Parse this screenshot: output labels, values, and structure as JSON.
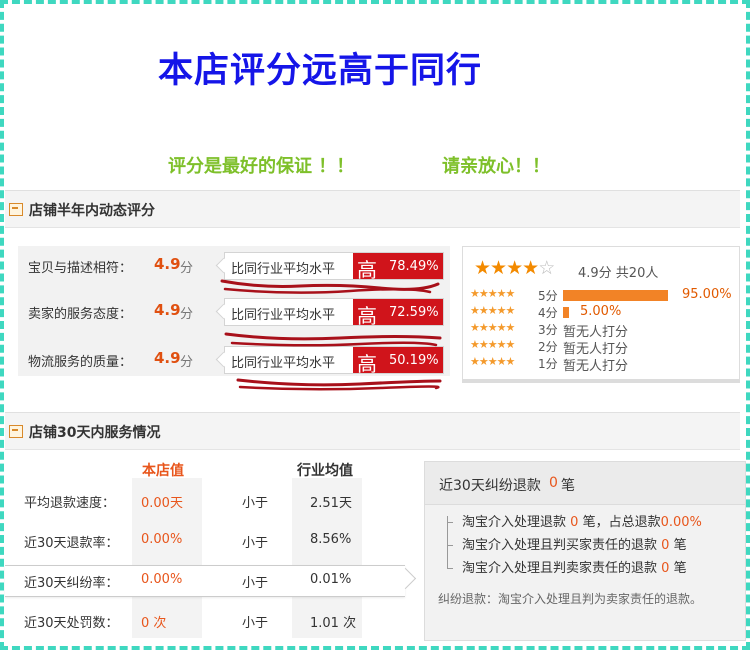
{
  "title": "本店评分远高于同行",
  "slogans": [
    "评分是最好的保证 ！！",
    "请亲放心！！"
  ],
  "rating_section": {
    "header": "店铺半年内动态评分",
    "unit": "分",
    "compare_label": "比同行业平均水平",
    "rows": [
      {
        "label": "宝贝与描述相符：",
        "score": "4.9",
        "level": "高",
        "pct": "78.49%"
      },
      {
        "label": "卖家的服务态度：",
        "score": "4.9",
        "level": "高",
        "pct": "72.59%"
      },
      {
        "label": "物流服务的质量：",
        "score": "4.9",
        "level": "高",
        "pct": "50.19%"
      }
    ],
    "summary": {
      "stars": 4.5,
      "text": "4.9分 共20人"
    },
    "distribution": [
      {
        "label": "5分",
        "percent": "95.00%",
        "value": 95.0
      },
      {
        "label": "4分",
        "percent": "5.00%",
        "value": 5.0
      },
      {
        "label": "3分",
        "percent": "暂无人打分",
        "value": 0
      },
      {
        "label": "2分",
        "percent": "暂无人打分",
        "value": 0
      },
      {
        "label": "1分",
        "percent": "暂无人打分",
        "value": 0
      }
    ]
  },
  "service_section": {
    "header": "店铺30天内服务情况",
    "col_store": "本店值",
    "col_industry": "行业均值",
    "rows": [
      {
        "label": "平均退款速度：",
        "value": "0.00天",
        "cmp": "小于",
        "avg": "2.51天"
      },
      {
        "label": "近30天退款率：",
        "value": "0.00%",
        "cmp": "小于",
        "avg": "8.56%"
      },
      {
        "label": "近30天纠纷率：",
        "value": "0.00%",
        "cmp": "小于",
        "avg": "0.01%"
      },
      {
        "label": "近30天处罚数：",
        "value": "0 次",
        "cmp": "小于",
        "avg": "1.01 次"
      }
    ]
  },
  "dispute": {
    "title_pre": "近30天纠纷退款",
    "title_count": "0",
    "title_post": "笔",
    "lines": [
      {
        "pre": "淘宝介入处理退款",
        "count": "0",
        "post": "笔，占总退款",
        "pct": "0.00%"
      },
      {
        "pre": "淘宝介入处理且判买家责任的退款",
        "count": "0",
        "post": "笔",
        "pct": ""
      },
      {
        "pre": "淘宝介入处理且判卖家责任的退款",
        "count": "0",
        "post": "笔",
        "pct": ""
      }
    ],
    "footnote": "纠纷退款：淘宝介入处理且判为卖家责任的退款。"
  },
  "colors": {
    "accent_red": "#d0141b",
    "star_orange": "#f38a00",
    "title_blue": "#1515e8",
    "slogan_green": "#7ec02a",
    "frame_teal": "#3fd8c0"
  },
  "icons": [
    "panel-header-icon",
    "star-icon"
  ]
}
